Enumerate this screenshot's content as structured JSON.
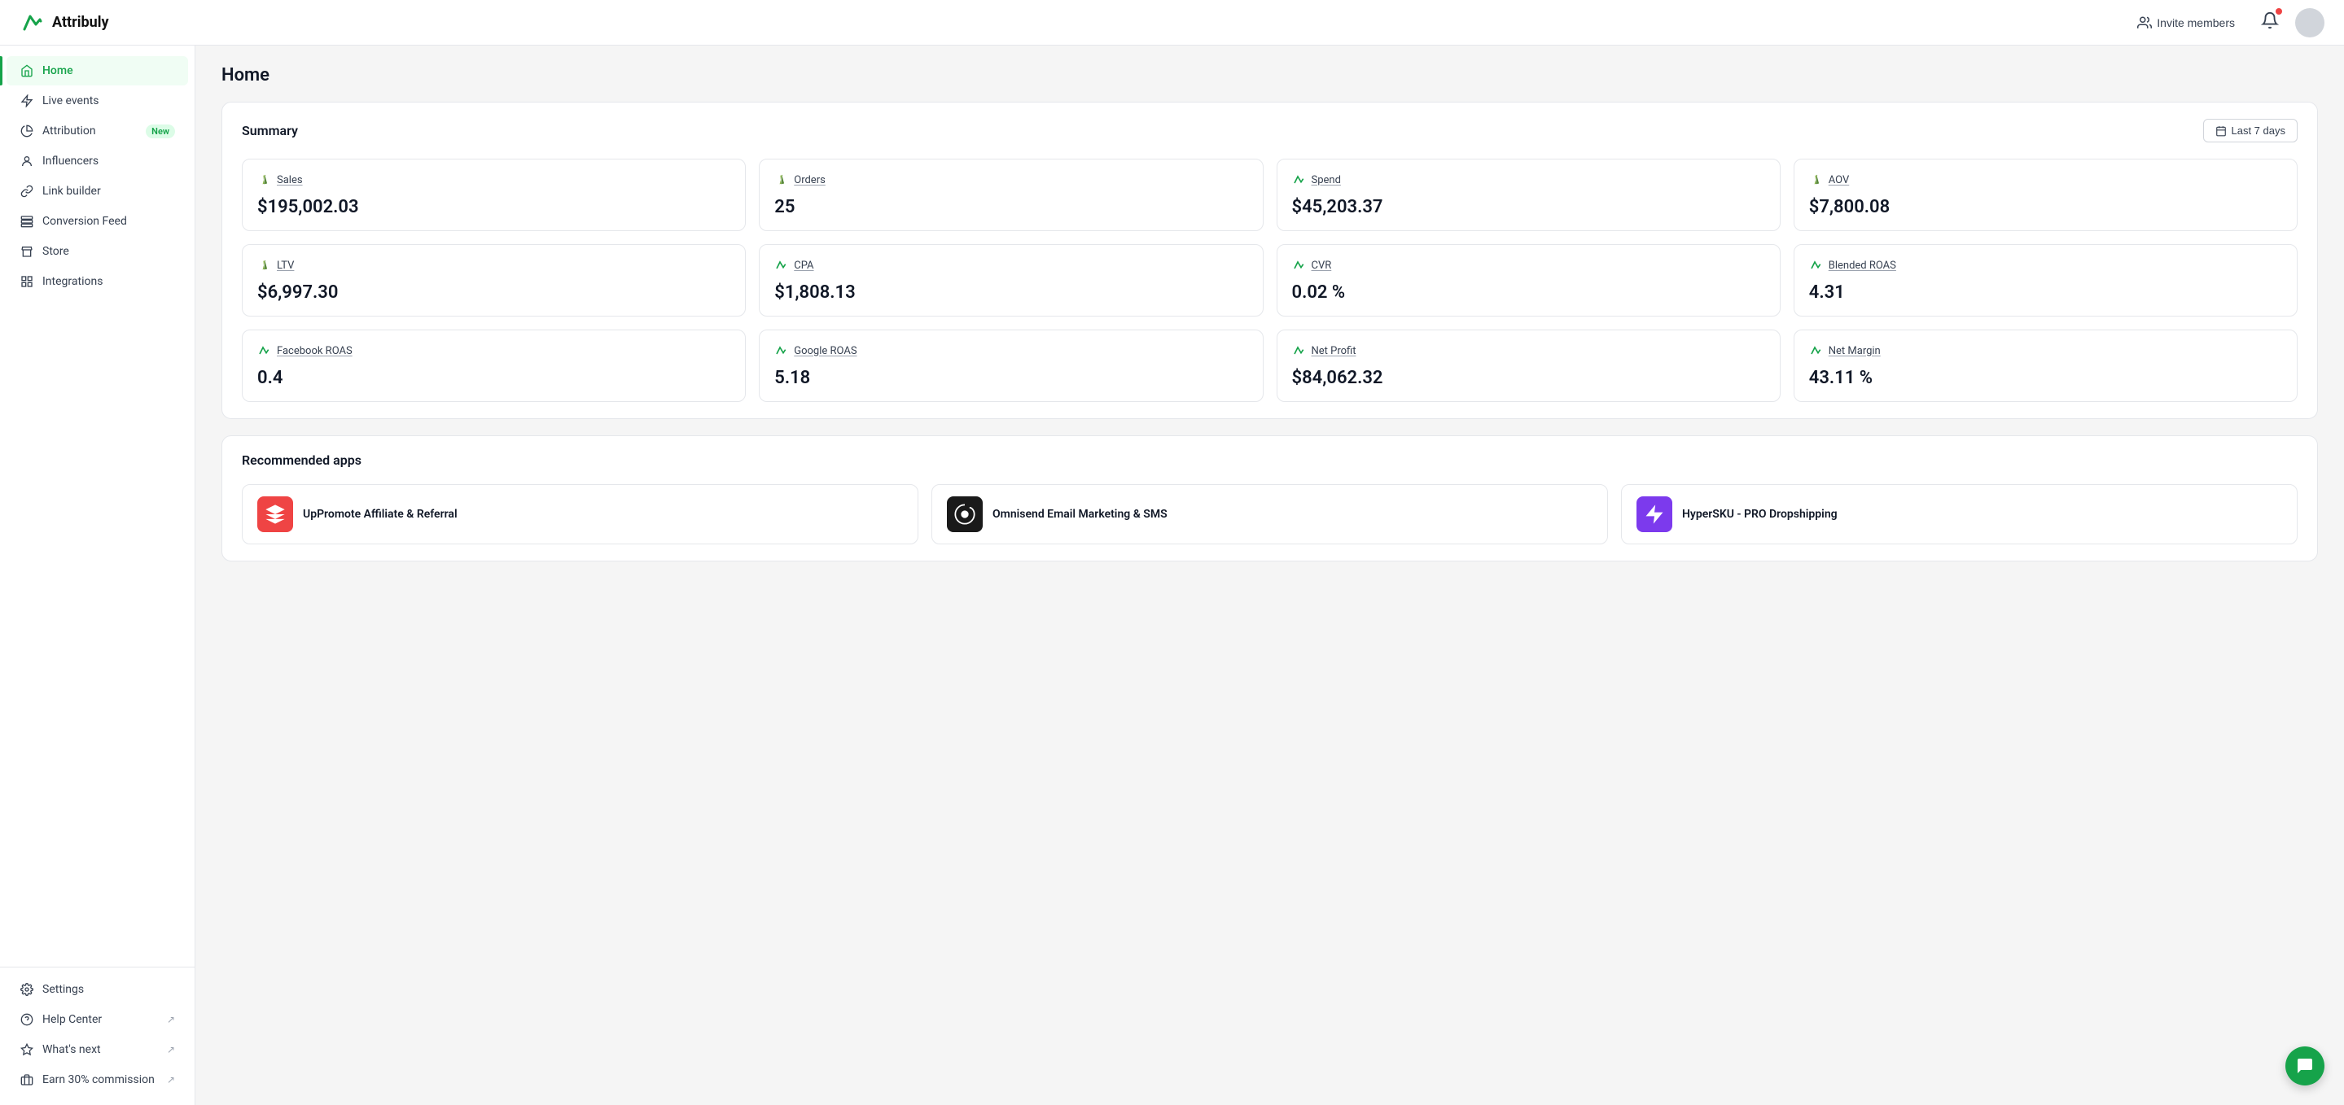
{
  "app": {
    "name": "Attribuly"
  },
  "header": {
    "invite_label": "Invite members",
    "avatar_alt": "User avatar"
  },
  "sidebar": {
    "items": [
      {
        "id": "home",
        "label": "Home",
        "active": true,
        "external": false,
        "badge": null
      },
      {
        "id": "live-events",
        "label": "Live events",
        "active": false,
        "external": false,
        "badge": null
      },
      {
        "id": "attribution",
        "label": "Attribution",
        "active": false,
        "external": false,
        "badge": "New"
      },
      {
        "id": "influencers",
        "label": "Influencers",
        "active": false,
        "external": false,
        "badge": null
      },
      {
        "id": "link-builder",
        "label": "Link builder",
        "active": false,
        "external": false,
        "badge": null
      },
      {
        "id": "conversion-feed",
        "label": "Conversion Feed",
        "active": false,
        "external": false,
        "badge": null
      },
      {
        "id": "store",
        "label": "Store",
        "active": false,
        "external": false,
        "badge": null
      },
      {
        "id": "integrations",
        "label": "Integrations",
        "active": false,
        "external": false,
        "badge": null
      }
    ],
    "bottom_items": [
      {
        "id": "settings",
        "label": "Settings",
        "external": false
      },
      {
        "id": "help-center",
        "label": "Help Center",
        "external": true
      },
      {
        "id": "whats-next",
        "label": "What's next",
        "external": true
      },
      {
        "id": "earn-commission",
        "label": "Earn 30% commission",
        "external": true
      }
    ]
  },
  "main": {
    "page_title": "Home",
    "summary": {
      "title": "Summary",
      "date_filter": "Last 7 days",
      "metrics": [
        {
          "id": "sales",
          "label": "Sales",
          "value": "$195,002.03",
          "icon_type": "shopify"
        },
        {
          "id": "orders",
          "label": "Orders",
          "value": "25",
          "icon_type": "shopify"
        },
        {
          "id": "spend",
          "label": "Spend",
          "value": "$45,203.37",
          "icon_type": "attribuly"
        },
        {
          "id": "aov",
          "label": "AOV",
          "value": "$7,800.08",
          "icon_type": "shopify"
        },
        {
          "id": "ltv",
          "label": "LTV",
          "value": "$6,997.30",
          "icon_type": "shopify"
        },
        {
          "id": "cpa",
          "label": "CPA",
          "value": "$1,808.13",
          "icon_type": "attribuly"
        },
        {
          "id": "cvr",
          "label": "CVR",
          "value": "0.02 %",
          "icon_type": "attribuly"
        },
        {
          "id": "blended-roas",
          "label": "Blended ROAS",
          "value": "4.31",
          "icon_type": "attribuly"
        },
        {
          "id": "facebook-roas",
          "label": "Facebook ROAS",
          "value": "0.4",
          "icon_type": "attribuly"
        },
        {
          "id": "google-roas",
          "label": "Google ROAS",
          "value": "5.18",
          "icon_type": "attribuly"
        },
        {
          "id": "net-profit",
          "label": "Net Profit",
          "value": "$84,062.32",
          "icon_type": "attribuly"
        },
        {
          "id": "net-margin",
          "label": "Net Margin",
          "value": "43.11 %",
          "icon_type": "attribuly"
        }
      ]
    },
    "recommended_apps": {
      "title": "Recommended apps",
      "apps": [
        {
          "id": "uppromote",
          "name": "UpPromote Affiliate & Referral",
          "bg": "#ef4444"
        },
        {
          "id": "omnisend",
          "name": "Omnisend Email Marketing & SMS",
          "bg": "#1a1a1a"
        },
        {
          "id": "hypersku",
          "name": "HyperSKU - PRO Dropshipping",
          "bg": "#7c3aed"
        }
      ]
    }
  }
}
